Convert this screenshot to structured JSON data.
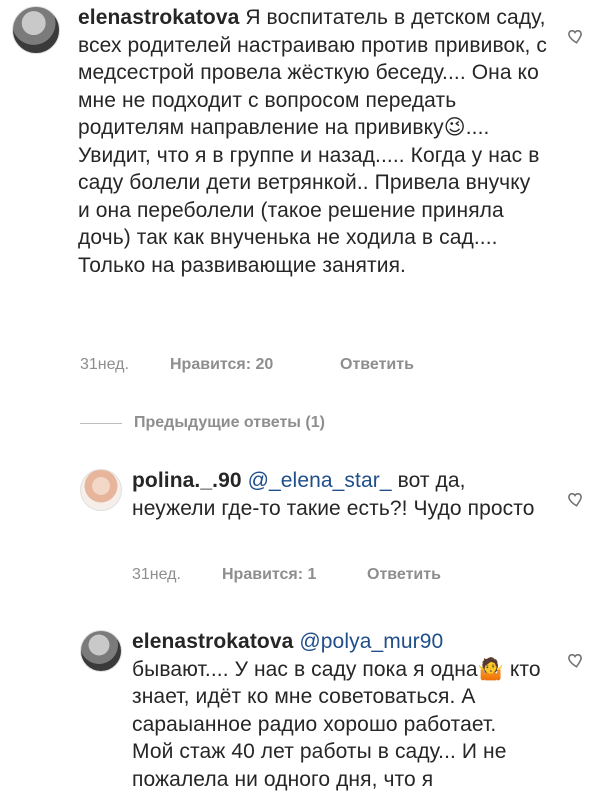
{
  "comments": [
    {
      "username": "elenastrokatova",
      "text": "Я воспитатель в детском саду, всех родителей настраиваю против прививок, с медсестрой провела жёсткую беседу.... Она ко мне не подходит с вопросом передать родителям направление на прививку😉.... Увидит, что я в группе и назад..... Когда у нас в саду болели дети ветрянкой.. Привела внучку и она переболели (такое решение приняла дочь) так как внученька не ходила в сад.... Только на развивающие занятия.",
      "time": "31нед.",
      "likes": "Нравится: 20",
      "reply": "Ответить"
    }
  ],
  "previous_replies": "Предыдущие ответы (1)",
  "replies": [
    {
      "username": "polina._.90",
      "mention": "@_elena_star_",
      "text": "вот да, неужели где-то такие есть?! Чудо просто",
      "time": "31нед.",
      "likes": "Нравится: 1",
      "reply": "Ответить"
    },
    {
      "username": "elenastrokatova",
      "mention": "@polya_mur90",
      "text": "бывают.... У нас в саду пока я одна🤷 кто знает, идёт ко мне советоваться. А сараыанное радио хорошо работает. Мой стаж 40 лет работы в саду... И не пожалела ни одного дня, что я"
    }
  ],
  "icons": {
    "like": "heart-outline-icon"
  }
}
